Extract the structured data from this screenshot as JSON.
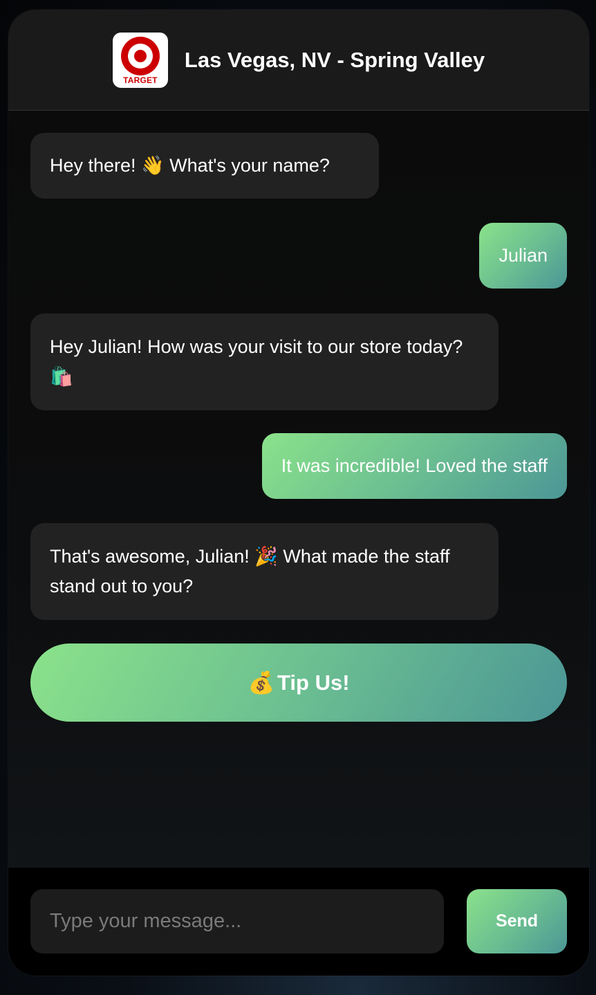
{
  "header": {
    "logo_text": "TARGET",
    "title": "Las Vegas, NV - Spring Valley"
  },
  "messages": [
    {
      "sender": "bot",
      "text": "Hey there! 👋 What's your name?"
    },
    {
      "sender": "user",
      "text": "Julian"
    },
    {
      "sender": "bot",
      "text": "Hey Julian! How was your visit to our store today? 🛍️"
    },
    {
      "sender": "user",
      "text": "It was incredible! Loved the staff"
    },
    {
      "sender": "bot",
      "text": "That's awesome, Julian! 🎉 What made the staff stand out to you?"
    }
  ],
  "tip_button": {
    "emoji": "💰",
    "label": "Tip Us!"
  },
  "input": {
    "placeholder": "Type your message...",
    "value": ""
  },
  "send_button": {
    "label": "Send"
  },
  "colors": {
    "accent_start": "#8be28a",
    "accent_end": "#4c9696",
    "bot_bubble": "#222222",
    "logo_red": "#cc0000"
  }
}
